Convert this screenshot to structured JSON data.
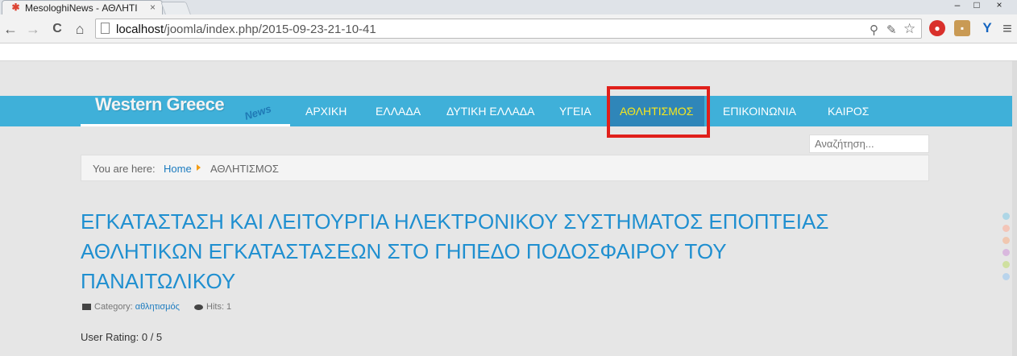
{
  "browser": {
    "tab_title": "MesologhiNews - ΑΘΛΗΤΙ",
    "tab_close": "×",
    "favicon_icon": "joomla-icon",
    "window_controls": {
      "minimize": "–",
      "maximize": "□",
      "close": "×"
    },
    "nav": {
      "back": "←",
      "forward": "→",
      "reload": "C",
      "home": "⌂"
    },
    "url_host": "localhost",
    "url_path": "/joomla/index.php/2015-09-23-21-10-41",
    "omnibox_icons": [
      "search-icon",
      "lightbulb-icon",
      "star-icon"
    ],
    "extensions": [
      {
        "name": "stop-extension-icon",
        "glyph": "●",
        "color": "#d9302b"
      },
      {
        "name": "pocket-extension-icon",
        "glyph": "▪",
        "color": "#c99a54"
      },
      {
        "name": "y-extension-icon",
        "glyph": "Y",
        "color": "#1565c0"
      }
    ],
    "menu_icon": "≡"
  },
  "site": {
    "logo_main": "Western Greece",
    "logo_sub": "News",
    "menu": [
      {
        "label": "ΑΡΧΙΚΗ",
        "active": false
      },
      {
        "label": "ΕΛΛΑΔΑ",
        "active": false
      },
      {
        "label": "ΔΥΤΙΚΗ ΕΛΛΑΔΑ",
        "active": false
      },
      {
        "label": "ΥΓΕΙΑ",
        "active": false
      },
      {
        "label": "ΑΘΛΗΤΙΣΜΟΣ",
        "active": true
      },
      {
        "label": "ΕΠΙΚΟΙΝΩΝΙΑ",
        "active": false
      },
      {
        "label": "ΚΑΙΡΟΣ",
        "active": false
      }
    ],
    "search_placeholder": "Αναζήτηση...",
    "breadcrumb": {
      "label": "You are here:",
      "home": "Home",
      "current": "ΑΘΛΗΤΙΣΜΟΣ"
    },
    "article": {
      "title": "ΕΓΚΑΤΑΣΤΑΣΗ ΚΑΙ ΛΕΙΤΟΥΡΓΙΑ ΗΛΕΚΤΡΟΝΙΚΟΥ ΣΥΣΤΗΜΑΤΟΣ ΕΠΟΠΤΕΙΑΣ ΑΘΛΗΤΙΚΩΝ ΕΓΚΑΤΑΣΤΑΣΕΩΝ ΣΤΟ ΓΗΠΕΔΟ ΠΟΔΟΣΦΑΙΡΟΥ ΤΟΥ ΠΑΝΑΙΤΩΛΙΚΟΥ",
      "category_label": "Category:",
      "category_value": "αθλητισμός",
      "hits_label": "Hits: 1",
      "rating": "User Rating:  0 / 5"
    },
    "color_swatches": [
      "#aed6e6",
      "#f3c5b8",
      "#f0c7b0",
      "#d9b8de",
      "#cfe0a0",
      "#b9d4ec"
    ],
    "colors": {
      "navbar": "#3fb0d9",
      "active_item_bg": "#2f86b9",
      "active_item_text": "#f8e71c",
      "title": "#1f8fd0",
      "annotation_box": "#e0201b"
    }
  }
}
